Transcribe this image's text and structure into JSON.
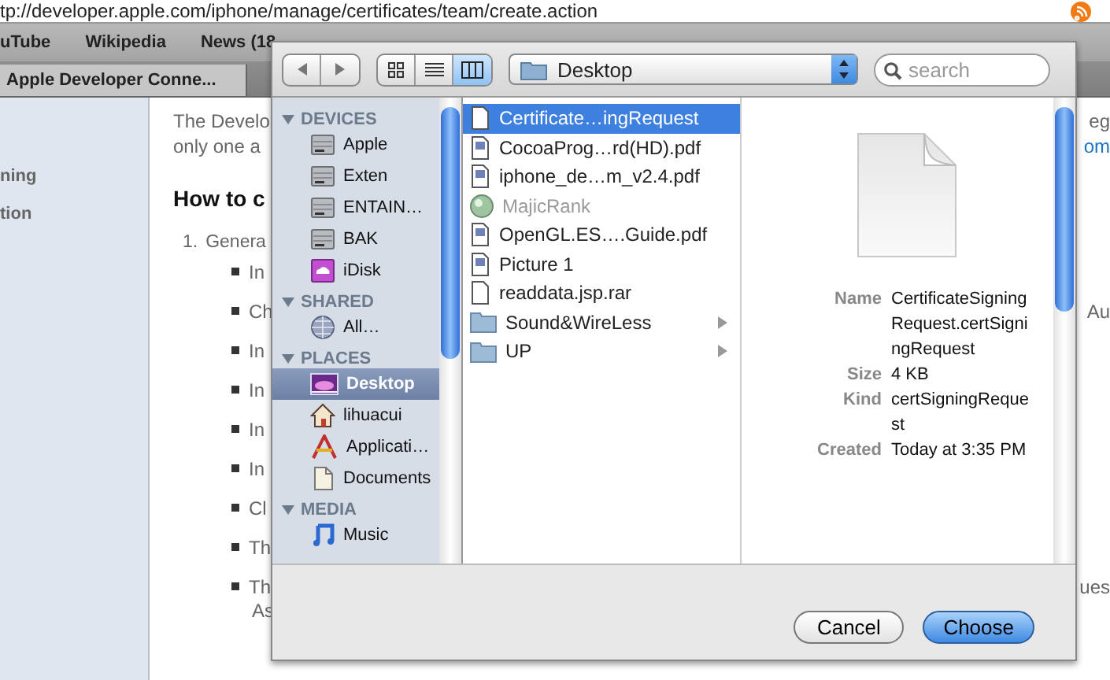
{
  "browser": {
    "address": "tp://developer.apple.com/iphone/manage/certificates/team/create.action",
    "bookmarks": [
      "uTube",
      "Wikipedia",
      "News (18"
    ],
    "tab": {
      "title": "Apple Developer Conne..."
    }
  },
  "page": {
    "sidebar_items": [
      "ning",
      "tion"
    ],
    "intro": [
      {
        "text": "The Develo",
        "end": "eg",
        "end_link": false
      },
      {
        "text": "only one a",
        "end": "om",
        "end_link": true
      }
    ],
    "heading": "How to c",
    "step": {
      "number": "1.",
      "text": "Genera"
    },
    "bullets": [
      {
        "text": "In"
      },
      {
        "text": "Ch",
        "end": "Au"
      },
      {
        "text": "In"
      },
      {
        "text": "In"
      },
      {
        "text": "In"
      },
      {
        "text": "In"
      },
      {
        "text": "Cl"
      },
      {
        "text": "Th"
      },
      {
        "text": "Th",
        "end": "ues"
      }
    ],
    "tail": "As"
  },
  "dialog": {
    "view_modes": [
      {
        "kind": "icons",
        "selected": false
      },
      {
        "kind": "list",
        "selected": false
      },
      {
        "kind": "columns",
        "selected": true
      }
    ],
    "location": "Desktop",
    "search": {
      "placeholder": "search"
    },
    "sidebar": [
      {
        "heading": "DEVICES",
        "expanded": true,
        "items": [
          {
            "label": "Apple",
            "kind": "disk",
            "selected": false
          },
          {
            "label": "Exten",
            "kind": "disk",
            "selected": false
          },
          {
            "label": "ENTAIN…",
            "kind": "disk",
            "selected": false
          },
          {
            "label": "BAK",
            "kind": "disk",
            "selected": false
          },
          {
            "label": "iDisk",
            "kind": "idisk",
            "selected": false
          }
        ]
      },
      {
        "heading": "SHARED",
        "expanded": true,
        "items": [
          {
            "label": "All…",
            "kind": "network",
            "selected": false
          }
        ]
      },
      {
        "heading": "PLACES",
        "expanded": true,
        "items": [
          {
            "label": "Desktop",
            "kind": "desktop",
            "selected": true
          },
          {
            "label": "lihuacui",
            "kind": "home",
            "selected": false
          },
          {
            "label": "Applicati…",
            "kind": "apps",
            "selected": false
          },
          {
            "label": "Documents",
            "kind": "docs",
            "selected": false
          }
        ]
      },
      {
        "heading": "MEDIA",
        "expanded": true,
        "items": [
          {
            "label": "Music",
            "kind": "music",
            "selected": false
          }
        ]
      }
    ],
    "files": [
      {
        "name": "Certificate…ingRequest",
        "kind": "doc",
        "selected": true,
        "disabled": false
      },
      {
        "name": "CocoaProg…rd(HD).pdf",
        "kind": "pdf",
        "selected": false,
        "disabled": false
      },
      {
        "name": "iphone_de…m_v2.4.pdf",
        "kind": "pdf",
        "selected": false,
        "disabled": false
      },
      {
        "name": "MajicRank",
        "kind": "app",
        "selected": false,
        "disabled": true
      },
      {
        "name": "OpenGL.ES….Guide.pdf",
        "kind": "pdf",
        "selected": false,
        "disabled": false
      },
      {
        "name": "Picture 1",
        "kind": "pdf",
        "selected": false,
        "disabled": false
      },
      {
        "name": "readdata.jsp.rar",
        "kind": "doc",
        "selected": false,
        "disabled": false
      },
      {
        "name": "Sound&WireLess",
        "kind": "folder",
        "selected": false,
        "disabled": false
      },
      {
        "name": "UP",
        "kind": "folder",
        "selected": false,
        "disabled": false
      }
    ],
    "preview": [
      {
        "label": "Name",
        "value": "CertificateSigningRequest.certSigningRequest"
      },
      {
        "label": "Size",
        "value": "4 KB"
      },
      {
        "label": "Kind",
        "value": "certSigningRequest"
      },
      {
        "label": "Created",
        "value": "Today at 3:35 PM"
      }
    ],
    "buttons": [
      {
        "label": "Cancel",
        "default": false
      },
      {
        "label": "Choose",
        "default": true
      }
    ]
  }
}
